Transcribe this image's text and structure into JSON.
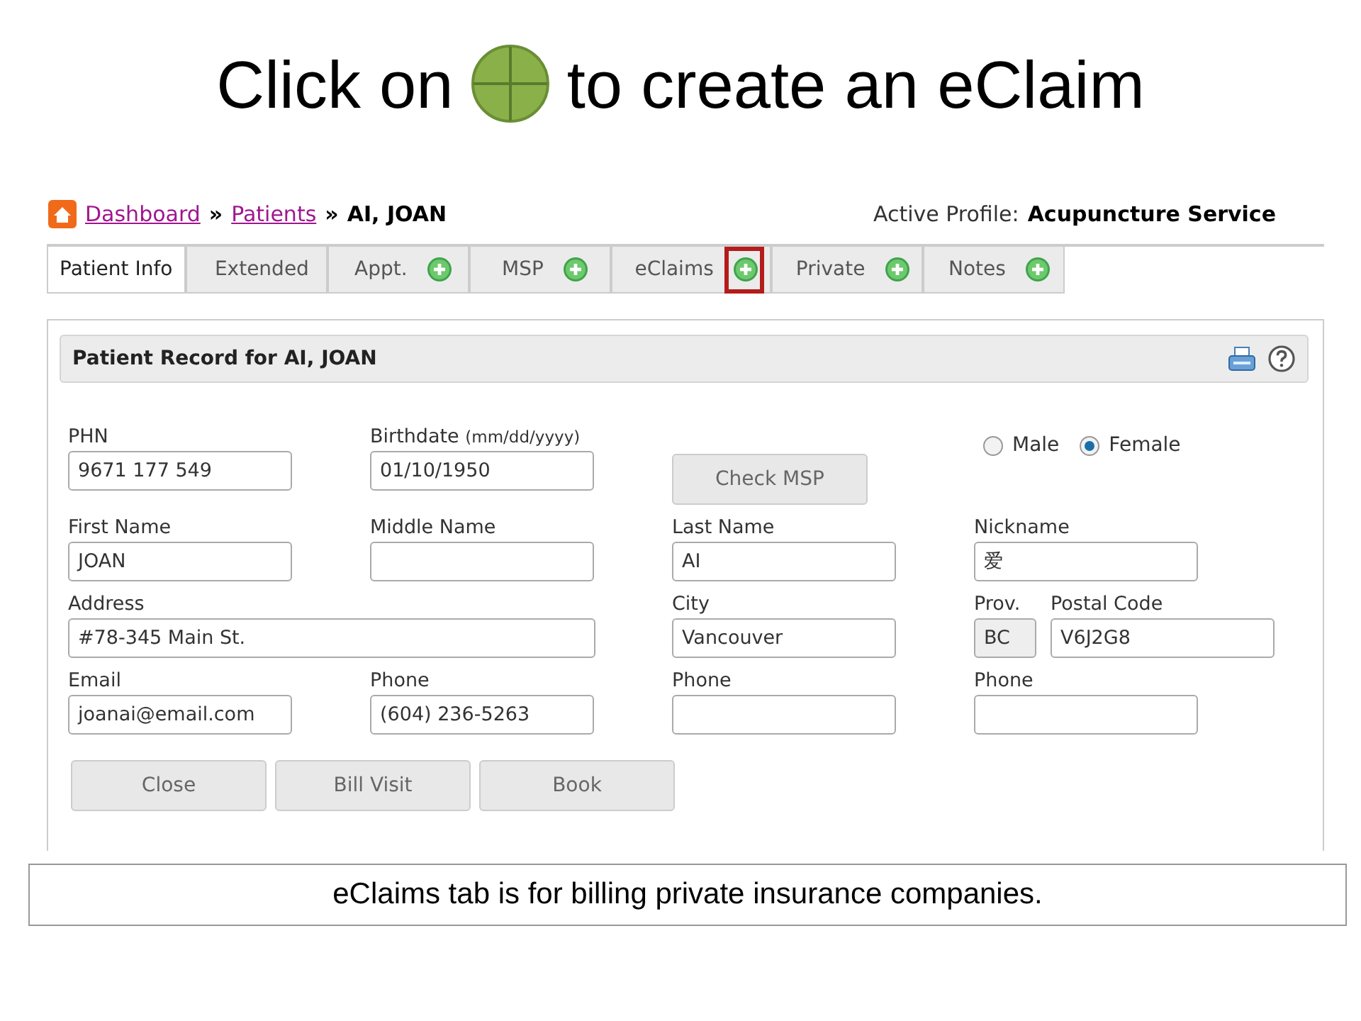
{
  "slide": {
    "title_before": "Click on",
    "title_after": "to create an eClaim",
    "caption": "eClaims tab is for billing private insurance companies."
  },
  "breadcrumb": {
    "links": [
      "Dashboard",
      "Patients"
    ],
    "separators": [
      "»",
      "»"
    ],
    "current": "AI, JOAN"
  },
  "active_profile": {
    "label": "Active Profile:",
    "value": "Acupuncture Service"
  },
  "tabs": [
    {
      "label": "Patient Info",
      "selected": true,
      "add": false,
      "highlighted": false
    },
    {
      "label": "Extended",
      "selected": false,
      "add": false,
      "highlighted": false
    },
    {
      "label": "Appt.",
      "selected": false,
      "add": true,
      "highlighted": false
    },
    {
      "label": "MSP",
      "selected": false,
      "add": true,
      "highlighted": false
    },
    {
      "label": "eClaims",
      "selected": false,
      "add": true,
      "highlighted": true
    },
    {
      "label": "Private",
      "selected": false,
      "add": true,
      "highlighted": false
    },
    {
      "label": "Notes",
      "selected": false,
      "add": true,
      "highlighted": false
    }
  ],
  "panel": {
    "title": "Patient Record for AI, JOAN",
    "rows": [
      [
        {
          "kind": "field",
          "label": "PHN",
          "value": "9671 177 549"
        },
        {
          "kind": "field",
          "label": "Birthdate",
          "hint": "(mm/dd/yyyy)",
          "value": "01/10/1950"
        },
        {
          "kind": "button",
          "label": "Check MSP"
        },
        {
          "kind": "gender",
          "options": [
            {
              "label": "Male",
              "selected": false
            },
            {
              "label": "Female",
              "selected": true
            }
          ]
        }
      ],
      [
        {
          "kind": "field",
          "label": "First Name",
          "value": "JOAN"
        },
        {
          "kind": "field",
          "label": "Middle Name"
        },
        {
          "kind": "field",
          "label": "Last Name",
          "value": "AI"
        },
        {
          "kind": "field",
          "label": "Nickname",
          "value": "爱"
        }
      ],
      [
        {
          "kind": "wide_field",
          "label": "Address",
          "value": "#78-345 Main St."
        },
        "",
        {
          "kind": "field",
          "label": "City",
          "value": "Vancouver"
        },
        {
          "kind": "pair",
          "fields": [
            {
              "label": "Prov.",
              "value": "BC",
              "readonly": true
            },
            {
              "label": "Postal Code",
              "value": "V6J2G8",
              "readonly": false
            }
          ]
        }
      ],
      [
        {
          "kind": "field",
          "label": "Email",
          "value": "joanai@email.com"
        },
        {
          "kind": "field",
          "label": "Phone",
          "value": "(604) 236-5263"
        },
        {
          "kind": "field",
          "label": "Phone"
        },
        {
          "kind": "field",
          "label": "Phone"
        }
      ]
    ],
    "buttons": [
      "Close",
      "Bill Visit",
      "Book"
    ]
  }
}
